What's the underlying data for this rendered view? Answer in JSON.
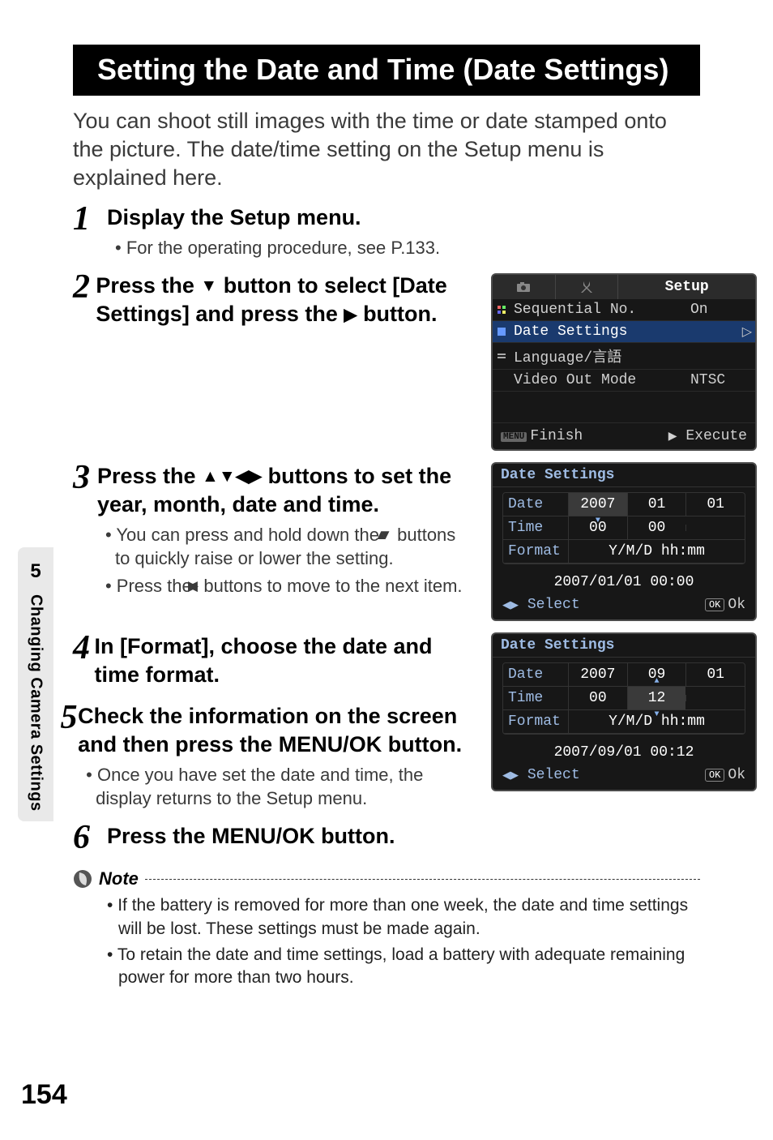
{
  "title": "Setting the Date and Time (Date Settings)",
  "intro": "You can shoot still images with the time or date stamped onto the picture.\nThe date/time setting on the Setup menu is explained here.",
  "steps": {
    "s1": {
      "num": "1",
      "title": "Display the Setup menu.",
      "sub1": "For the operating procedure, see P.133."
    },
    "s2": {
      "num": "2",
      "title_a": "Press the ",
      "title_b": " button to select [Date Settings] and press the ",
      "title_c": " button."
    },
    "s3": {
      "num": "3",
      "title_a": "Press the ",
      "title_b": " buttons to set the year, month, date and time.",
      "sub1_a": "You can press and hold down the ",
      "sub1_b": " buttons to quickly raise or lower the setting.",
      "sub2_a": "Press the ",
      "sub2_b": " buttons to move to the next item."
    },
    "s4": {
      "num": "4",
      "title": "In [Format], choose the date and time format."
    },
    "s5": {
      "num": "5",
      "title": "Check the information on the screen and then press the MENU/OK button.",
      "sub1": "Once you have set the date and time, the display returns to the Setup menu."
    },
    "s6": {
      "num": "6",
      "title": "Press the MENU/OK button."
    }
  },
  "setup_menu": {
    "tabs": {
      "cam": "📷",
      "tool": "🛠",
      "setup": "Setup"
    },
    "rows": [
      {
        "label": "Sequential No.",
        "value": "On",
        "sel": false
      },
      {
        "label": "Date Settings",
        "value": "",
        "sel": true
      },
      {
        "label": "Language/言語",
        "value": "",
        "sel": false
      },
      {
        "label": "Video Out Mode",
        "value": "NTSC",
        "sel": false
      }
    ],
    "foot_left": "Finish",
    "foot_right": "Execute",
    "menu_badge": "MENU",
    "foot_arrow": "▶"
  },
  "ds1": {
    "title": "Date Settings",
    "rows": {
      "date_label": "Date",
      "date_cells": [
        "2007",
        "01",
        "01"
      ],
      "date_sel": 0,
      "time_label": "Time",
      "time_cells": [
        "00",
        "00"
      ],
      "format_label": "Format",
      "format_value": "Y/M/D hh:mm"
    },
    "preview": "2007/01/01 00:00",
    "foot_left": "Select",
    "foot_arrows": "◀▶",
    "foot_ok": "Ok",
    "ok_badge": "OK"
  },
  "ds2": {
    "title": "Date Settings",
    "rows": {
      "date_label": "Date",
      "date_cells": [
        "2007",
        "09",
        "01"
      ],
      "time_label": "Time",
      "time_cells": [
        "00",
        "12"
      ],
      "time_sel": 1,
      "format_label": "Format",
      "format_value": "Y/M/D hh:mm"
    },
    "preview": "2007/09/01 00:12",
    "foot_left": "Select",
    "foot_arrows": "◀▶",
    "foot_ok": "Ok",
    "ok_badge": "OK"
  },
  "note": {
    "label": "Note",
    "items": [
      "If the battery is removed for more than one week, the date and time settings will be lost. These settings must be made again.",
      "To retain the date and time settings, load a battery with adequate remaining power for more than two hours."
    ]
  },
  "side": {
    "num": "5",
    "label": "Changing Camera Settings"
  },
  "page": "154"
}
